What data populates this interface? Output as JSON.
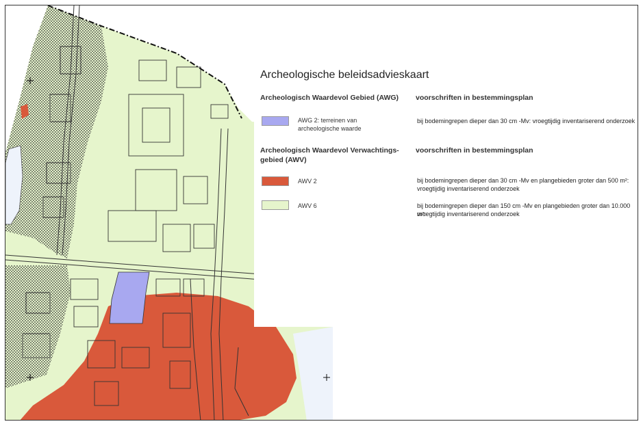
{
  "legend": {
    "title": "Archeologische beleidsadvieskaart",
    "section1": {
      "heading": "Archeologisch Waardevol Gebied (AWG)",
      "column_heading": "voorschriften in bestemmingsplan",
      "items": [
        {
          "label_line1": "AWG 2: terreinen van",
          "label_line2": "archeologische waarde",
          "description_line1": "bij bodemingrepen dieper dan 30 cm -Mv: vroegtijdig inventariserend onderzoek",
          "description_line2": "",
          "color": "#a8a8f0"
        }
      ]
    },
    "section2": {
      "heading_line1": "Archeologisch Waardevol Verwachtings-",
      "heading_line2": "gebied (AWV)",
      "column_heading": "voorschriften in bestemmingsplan",
      "items": [
        {
          "label_line1": "AWV 2",
          "label_line2": "",
          "description_line1": "bij bodemingrepen dieper dan 30 cm -Mv en plangebieden groter dan 500 m²:",
          "description_line2": "vroegtijdig inventariserend onderzoek",
          "color": "#d9593b"
        },
        {
          "label_line1": "AWV 6",
          "label_line2": "",
          "description_line1": "bij bodemingrepen dieper dan 150 cm -Mv en plangebieden groter dan 10.000 m²:",
          "description_line2": "vroegtijdig inventariserend onderzoek",
          "color": "#e6f5cc"
        }
      ]
    }
  },
  "map": {
    "colors": {
      "awv6_fill": "#e6f5cc",
      "awv2_fill": "#d9593b",
      "awg2_fill": "#a8a8f0",
      "water_fill": "#eef3fb",
      "building_line": "#333333",
      "boundary_line": "#111111"
    },
    "markers": [
      "crosshair-marker",
      "crosshair-marker",
      "crosshair-marker"
    ]
  }
}
